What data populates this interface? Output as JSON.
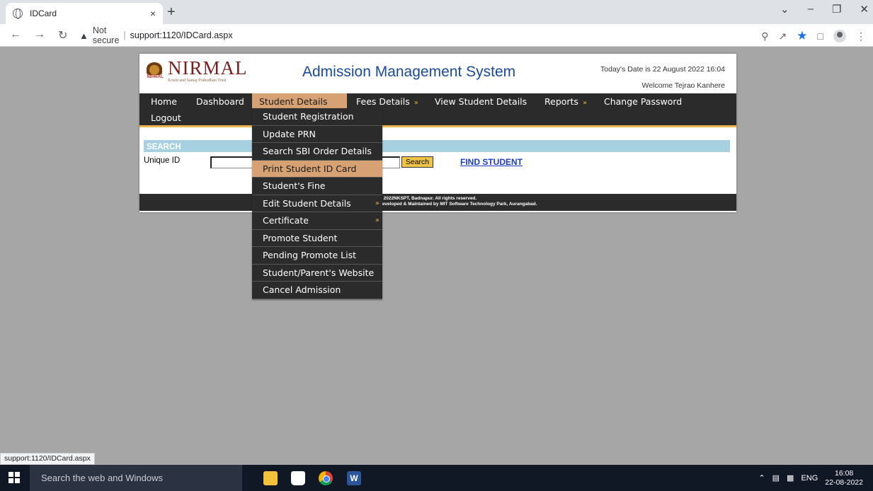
{
  "browser": {
    "tab_title": "IDCard",
    "tab_close": "×",
    "new_tab": "+",
    "security_label": "Not secure",
    "url": "support:1120/IDCard.aspx",
    "window_controls": [
      "⌄",
      "–",
      "❐",
      "✕"
    ]
  },
  "header": {
    "brand": "NIRMAL",
    "brand_sub": "Krishi and Samaj Prabodhan Trust",
    "emblem_label": "NIRMAL",
    "app_title": "Admission Management System",
    "date_text": "Today's Date is 22 August 2022 16:04",
    "welcome_text": "Welcome Tejrao Kanhere"
  },
  "menu": {
    "home": "Home",
    "dashboard": "Dashboard",
    "student_details": "Student Details",
    "fees_details": "Fees Details",
    "view_student_details": "View Student Details",
    "reports": "Reports",
    "change_password": "Change Password",
    "logout": "Logout",
    "submenu_arrow": "»"
  },
  "dropdown": {
    "items": [
      {
        "label": "Student Registration"
      },
      {
        "label": "Update PRN"
      },
      {
        "label": "Search SBI Order Details"
      },
      {
        "label": "Print Student ID Card"
      },
      {
        "label": "Student's Fine"
      },
      {
        "label": "Edit Student Details"
      },
      {
        "label": "Certificate"
      },
      {
        "label": "Promote Student"
      },
      {
        "label": "Pending Promote List"
      },
      {
        "label": "Student/Parent's Website"
      },
      {
        "label": "Cancel Admission"
      }
    ],
    "highlighted_index": 3
  },
  "search": {
    "section_title": "SEARCH",
    "unique_id_label": "Unique ID",
    "unique_id_value": "",
    "search_button": "Search",
    "find_student": "FIND STUDENT"
  },
  "footer": {
    "line1": "© 2022NKSPT, Badnapur. All rights reserved.",
    "line2": "Developed & Maintained by MIT Software Technology Park, Aurangabad."
  },
  "status_bar": "support:1120/IDCard.aspx",
  "taskbar": {
    "search_placeholder": "Search the web and Windows",
    "word_icon_letter": "W",
    "language": "ENG",
    "time": "16:08",
    "date": "22-08-2022"
  },
  "colors": {
    "menu_bg": "#2b2b2b",
    "menu_highlight": "#d6a274",
    "accent_gold": "#e8b54c",
    "search_bar": "#a7d0e0",
    "title_blue": "#1a4a9a",
    "link_blue": "#1b3cc4"
  }
}
